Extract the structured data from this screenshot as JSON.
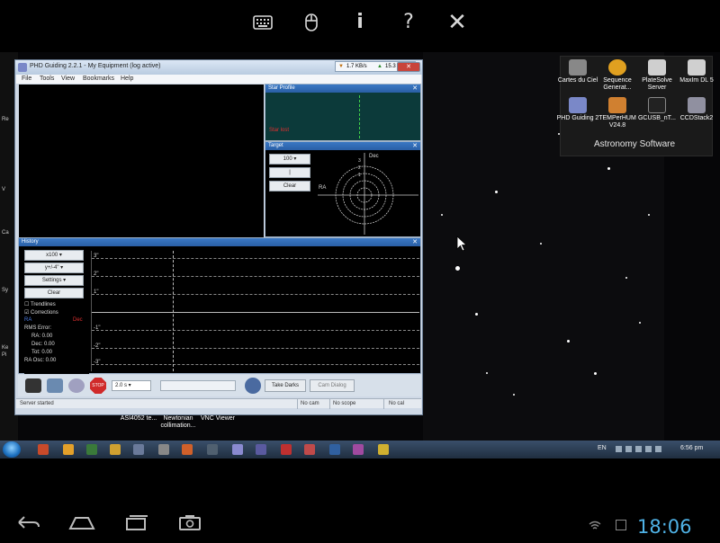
{
  "vnc_toolbar": {
    "keyboard": "keyboard-icon",
    "mouse": "mouse-icon",
    "info": "i",
    "help": "?",
    "close": "✕"
  },
  "desktop": {
    "left_edge_labels": [
      "Re",
      "V",
      "Ca",
      "Sy",
      "Ke",
      "Pi"
    ],
    "icons": [
      {
        "label": "Cartes du Ciel",
        "color": "#888888"
      },
      {
        "label": "Sequence Generat...",
        "color": "#e0a020"
      },
      {
        "label": "PlateSolve Server",
        "color": "#cfcfcf"
      },
      {
        "label": "MaxIm DL 5",
        "color": "#d0d0d0"
      },
      {
        "label": "PHD Guiding 2",
        "color": "#7a88c8"
      },
      {
        "label": "TEMPerHUM V24.8",
        "color": "#d08030"
      },
      {
        "label": "GCUSB_nT...",
        "color": "#222222"
      },
      {
        "label": "CCDStack2",
        "color": "#9090a0"
      }
    ],
    "astro_panel_title": "Astronomy Software",
    "bottom_icons": [
      {
        "label": "ASI4052 te..."
      },
      {
        "label": "Newtonian collimation..."
      },
      {
        "label": "VNC Viewer"
      }
    ]
  },
  "phd": {
    "title": "PHD Guiding 2.2.1 - My Equipment (log active)",
    "net_down": "1.7 KB/s",
    "net_up": "15.3 KB/s",
    "menu": [
      "File",
      "Tools",
      "View",
      "Bookmarks",
      "Help"
    ],
    "star_profile": {
      "title": "Star Profile",
      "status": "Star lost"
    },
    "target": {
      "title": "Target",
      "zoom": "100",
      "clear": "Clear",
      "ra_label": "RA",
      "dec_label": "Dec",
      "ring_labels": [
        "3",
        "2",
        "1"
      ]
    },
    "history": {
      "title": "History",
      "x_select": "x100",
      "y_select": "y+/-4\"",
      "settings": "Settings",
      "clear": "Clear",
      "trendlines": "Trendlines",
      "corrections": "Corrections",
      "ra": "RA",
      "dec": "Dec",
      "rms_label": "RMS Error:",
      "ra_rms": "RA: 0.00",
      "dec_rms": "Dec: 0.00",
      "tot_rms": "Tot: 0.00",
      "ra_osc": "RA Osc: 0.00",
      "y_labels": [
        "3\"",
        "2\"",
        "1\"",
        "-1\"",
        "-2\"",
        "-3\""
      ]
    },
    "toolbar": {
      "exposure": "2.0 s",
      "take_darks": "Take Darks",
      "cam_dialog": "Cam Dialog"
    },
    "status": {
      "message": "Server started",
      "camera": "No cam",
      "scope": "No scope",
      "cal": "No cal"
    }
  },
  "taskbar": {
    "time": "6:56 pm",
    "icons": [
      "#c84a2a",
      "#e3a02a",
      "#3a7a3a",
      "#d0a030",
      "#6a7a9a",
      "#888888",
      "#d0602a",
      "#506070",
      "#8a8ad0",
      "#5a5aa0",
      "#c03030",
      "#c04a4a",
      "#3060a0",
      "#a04aa0",
      "#d0b030"
    ]
  },
  "android_nav": {
    "back": "back-icon",
    "home": "home-icon",
    "recents": "recents-icon",
    "screenshot": "screenshot-icon",
    "clock": "18:06"
  }
}
